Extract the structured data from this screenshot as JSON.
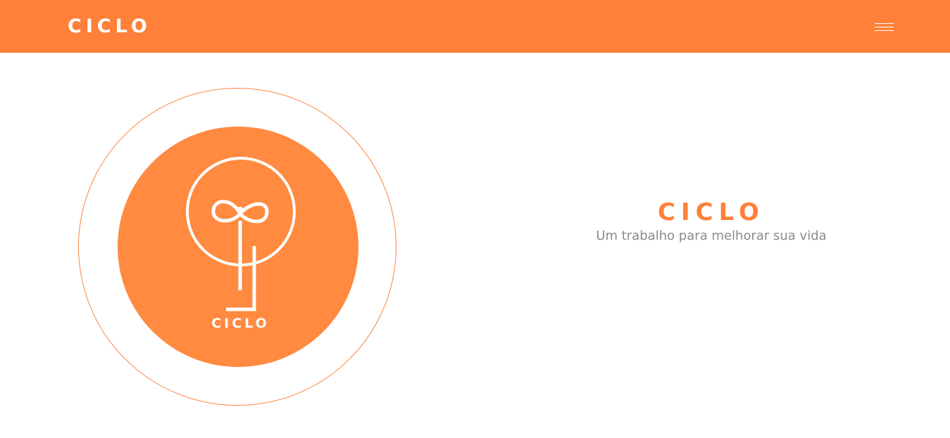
{
  "header": {
    "brand": "CICLO",
    "menu_icon": "hamburger-menu-icon"
  },
  "logo": {
    "wordmark": "CICLO",
    "icon": "ciclo-logo-icon"
  },
  "hero": {
    "title": "CICLO",
    "subtitle": "Um trabalho para melhorar sua vida"
  },
  "colors": {
    "brand": "#ff8038",
    "logo_fill": "#ff8a40",
    "subtitle": "#8a8a8a",
    "background": "#ffffff"
  }
}
